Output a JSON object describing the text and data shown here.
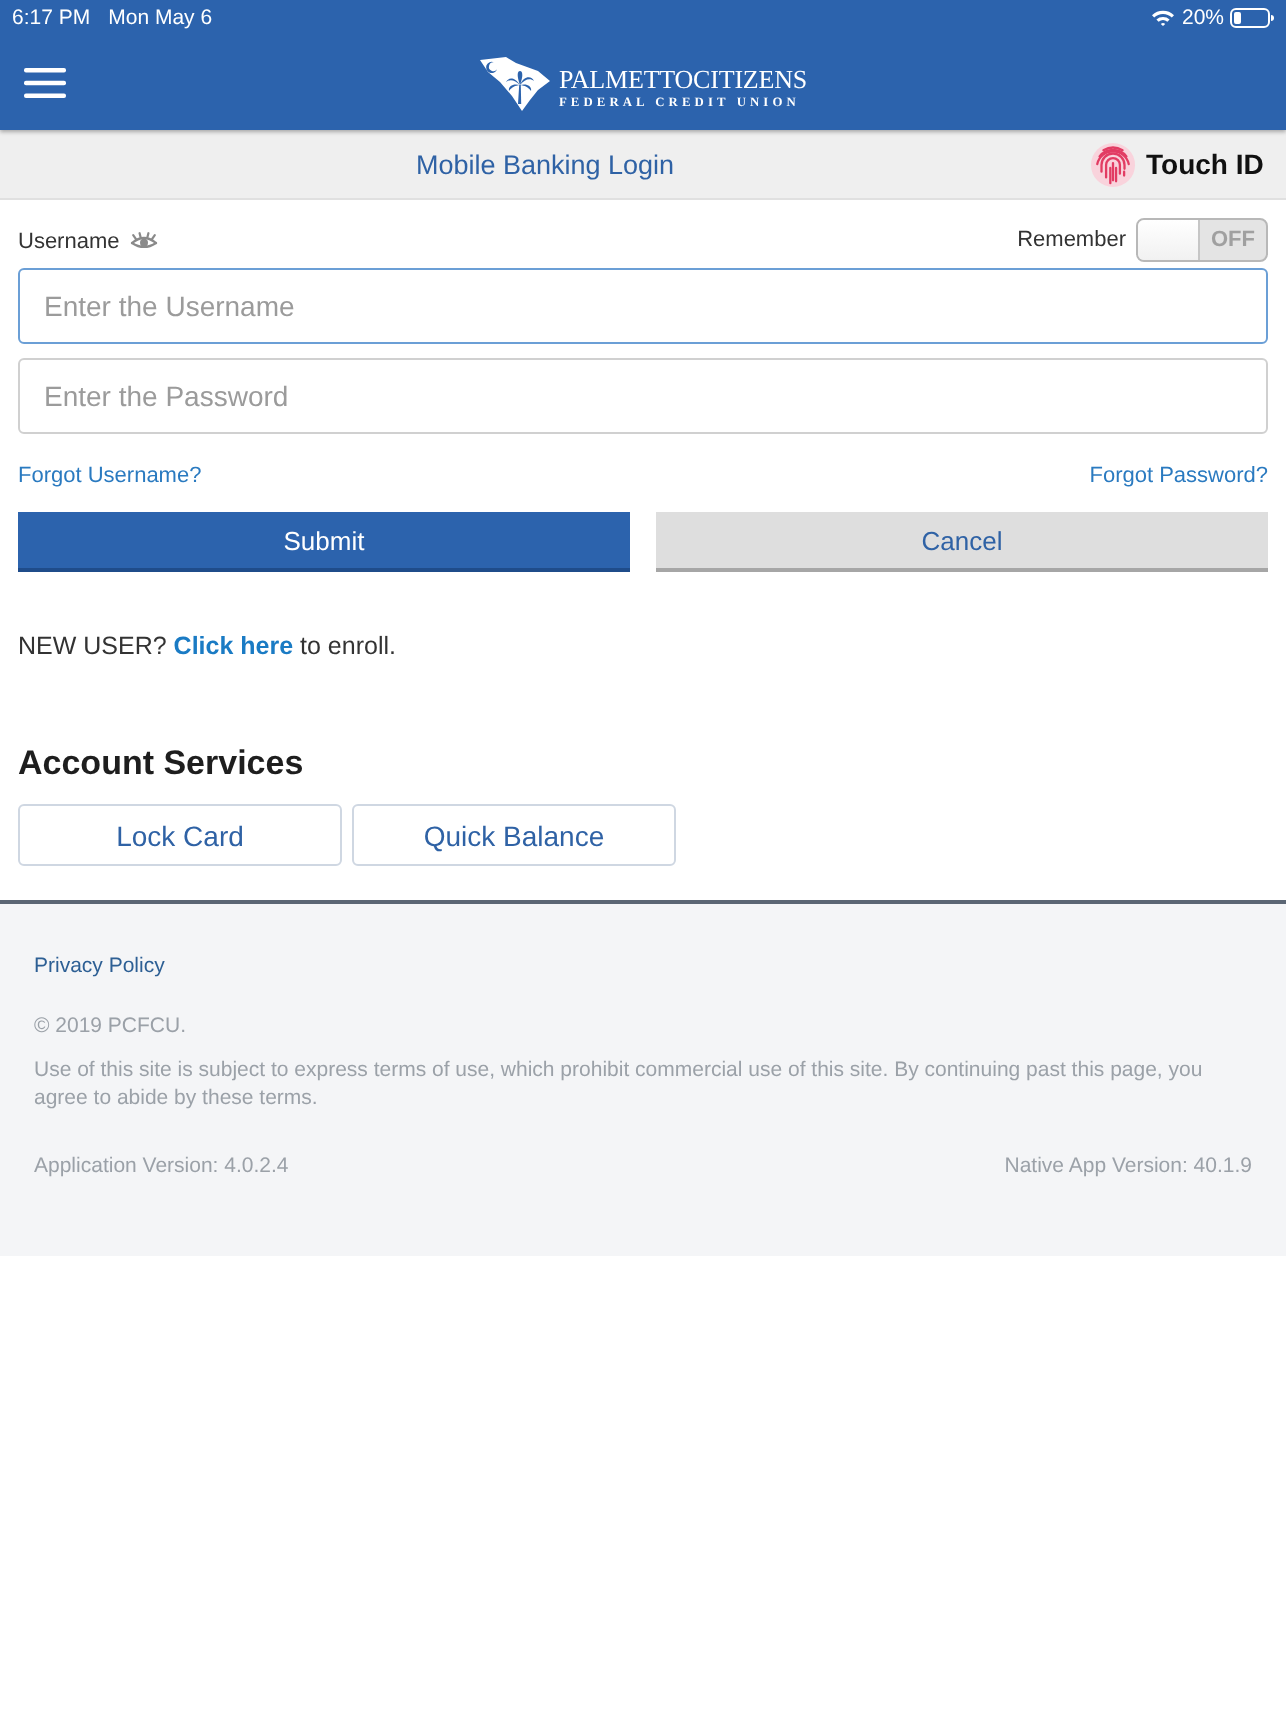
{
  "status_bar": {
    "time": "6:17 PM",
    "date": "Mon May 6",
    "battery": "20%"
  },
  "header": {
    "logo_title": "PALMETTOCITIZENS",
    "logo_subtitle": "FEDERAL CREDIT UNION"
  },
  "title_bar": {
    "title": "Mobile Banking Login",
    "touch_id": "Touch ID"
  },
  "login": {
    "username_label": "Username",
    "remember": {
      "label": "Remember",
      "on": false,
      "text": "OFF"
    },
    "fields": [
      {
        "placeholder": "Enter the Username",
        "focused": true
      },
      {
        "placeholder": "Enter the Password",
        "focused": false
      }
    ],
    "links": [
      "Forgot Username?",
      "Forgot Password?"
    ],
    "buttons": [
      {
        "kind": "primary",
        "label": "Submit"
      },
      {
        "kind": "secondary",
        "label": "Cancel"
      }
    ],
    "enroll": {
      "before": "NEW USER?",
      "link": "Click here",
      "after": "to enroll."
    }
  },
  "account_services": {
    "title": "Account Services",
    "buttons": [
      "Lock Card",
      "Quick Balance"
    ]
  },
  "footer": {
    "privacy": "Privacy Policy",
    "copyright": "© 2019 PCFCU.",
    "terms": "Use of this site is subject to express terms of use, which prohibit commercial use of this site. By continuing past this page, you agree to abide by these terms.",
    "app_version": "Application Version: 4.0.2.4",
    "native_version": "Native App Version: 40.1.9"
  }
}
